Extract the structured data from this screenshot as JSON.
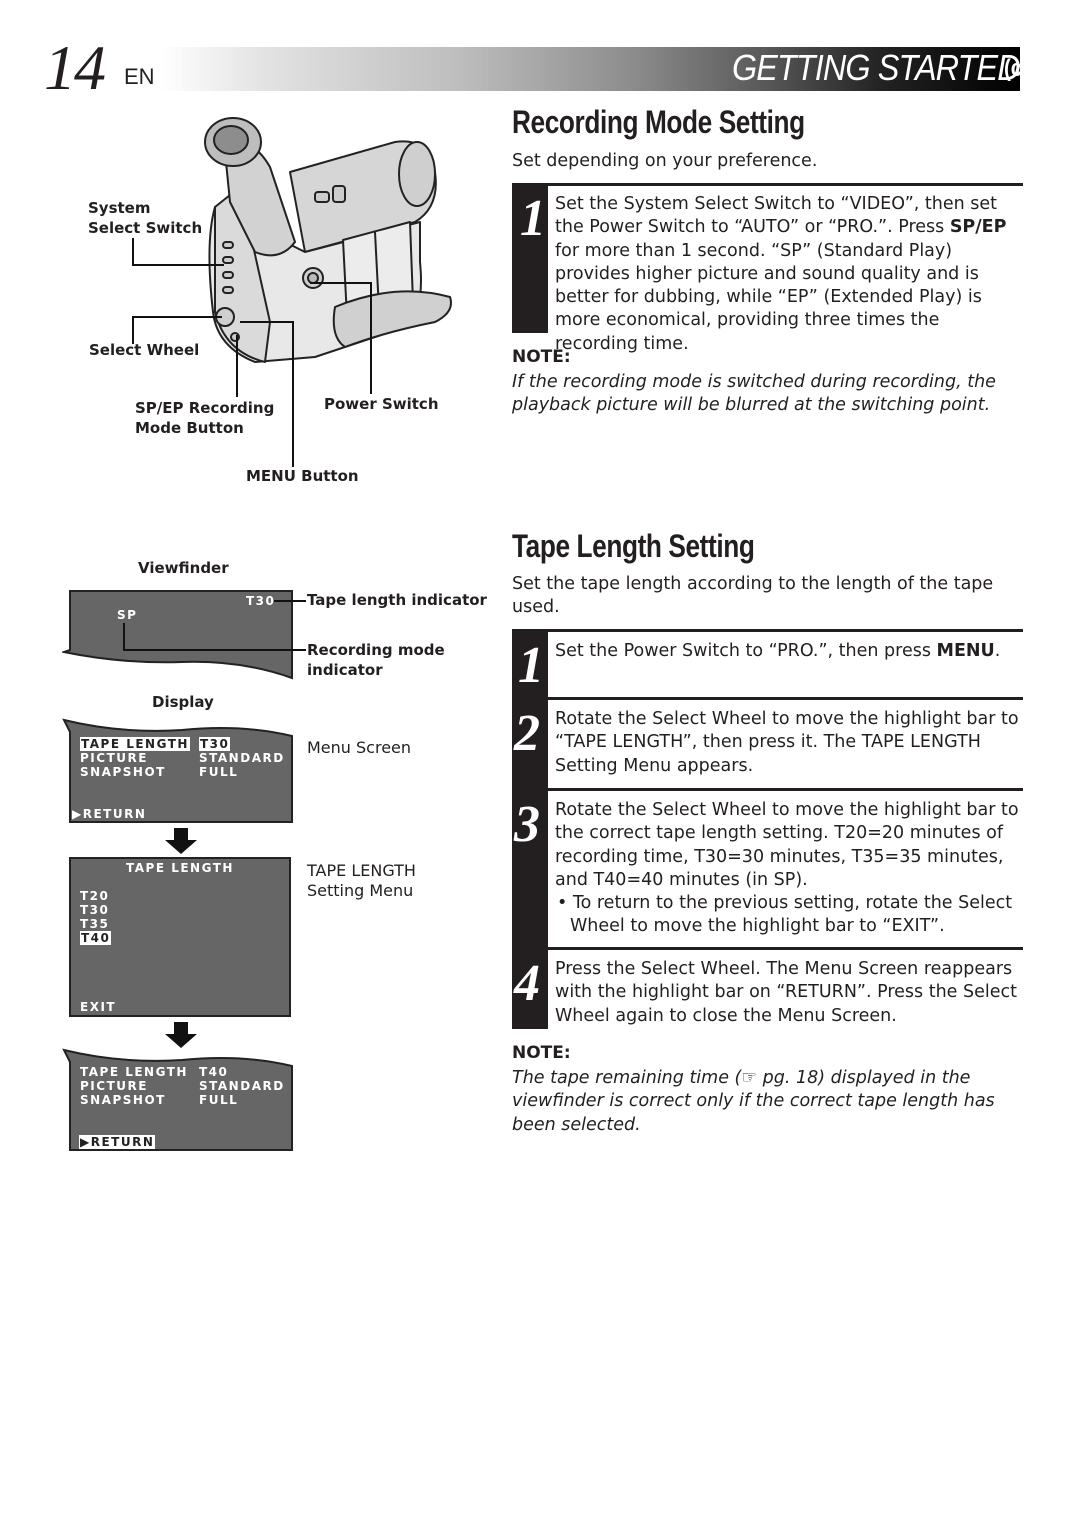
{
  "header": {
    "page_number": "14",
    "language": "EN",
    "section_title": "GETTING STARTED",
    "section_suffix": "(cont.)"
  },
  "camcorder_diagram": {
    "labels": {
      "system_select_switch_1": "System",
      "system_select_switch_2": "Select Switch",
      "select_wheel": "Select Wheel",
      "sp_ep_button_1": "SP/EP Recording",
      "sp_ep_button_2": "Mode Button",
      "power_switch": "Power Switch",
      "menu_button": "MENU Button"
    }
  },
  "viewfinder": {
    "title": "Viewfinder",
    "tape_indicator": "T30",
    "mode_indicator": "SP",
    "tape_length_label": "Tape length indicator",
    "recording_mode_label_1": "Recording mode",
    "recording_mode_label_2": "indicator"
  },
  "display": {
    "title": "Display",
    "menu_screen": {
      "label": "Menu Screen",
      "rows": [
        {
          "name": "TAPE LENGTH",
          "value": "T30"
        },
        {
          "name": "PICTURE",
          "value": "STANDARD"
        },
        {
          "name": "SNAPSHOT",
          "value": "FULL"
        }
      ],
      "return": "▶RETURN"
    },
    "tape_length_menu": {
      "label_1": "TAPE LENGTH",
      "label_2": "Setting Menu",
      "title": "TAPE LENGTH",
      "options": [
        "T20",
        "T30",
        "T35",
        "T40"
      ],
      "selected": "T40",
      "exit": "EXIT"
    },
    "menu_screen_after": {
      "rows": [
        {
          "name": "TAPE LENGTH",
          "value": "T40"
        },
        {
          "name": "PICTURE",
          "value": "STANDARD"
        },
        {
          "name": "SNAPSHOT",
          "value": "FULL"
        }
      ],
      "return": "▶RETURN"
    }
  },
  "recording_mode": {
    "title": "Recording Mode Setting",
    "intro": "Set depending on your preference.",
    "steps": [
      {
        "num": "1",
        "pre": "Set the System Select Switch to “VIDEO”, then set the Power Switch to “AUTO” or “PRO.”. Press ",
        "bold": "SP/EP",
        "post": " for more than 1 second. “SP” (Standard Play) provides higher picture and sound quality and is better for dubbing, while “EP” (Extended Play) is more economical, providing three times the recording time."
      }
    ],
    "note_heading": "NOTE:",
    "note": "If the recording mode is switched during recording, the playback picture will be blurred at the switching point."
  },
  "tape_length": {
    "title": "Tape Length Setting",
    "intro": "Set the tape length according to the length of the tape used.",
    "steps": [
      {
        "num": "1",
        "pre": "Set the Power Switch to “PRO.”, then press ",
        "bold": "MENU",
        "post": "."
      },
      {
        "num": "2",
        "text": "Rotate the Select Wheel to move the highlight bar to “TAPE LENGTH”, then press it. The TAPE LENGTH Setting Menu appears."
      },
      {
        "num": "3",
        "text": "Rotate the Select Wheel to move the highlight bar to the correct tape length setting. T20=20 minutes of recording time, T30=30 minutes, T35=35 minutes, and T40=40 minutes (in SP).",
        "bullet": "To return to the previous setting, rotate the Select Wheel to move the highlight bar to “EXIT”."
      },
      {
        "num": "4",
        "text": "Press the Select Wheel. The Menu Screen reappears with the highlight bar on “RETURN”. Press the Select Wheel again to close the Menu Screen."
      }
    ],
    "note_heading": "NOTE:",
    "note_pre": "The tape remaining time (",
    "note_ref_icon": "☞",
    "note_post": " pg. 18) displayed in the viewfinder is correct only if the correct tape length has been selected."
  }
}
